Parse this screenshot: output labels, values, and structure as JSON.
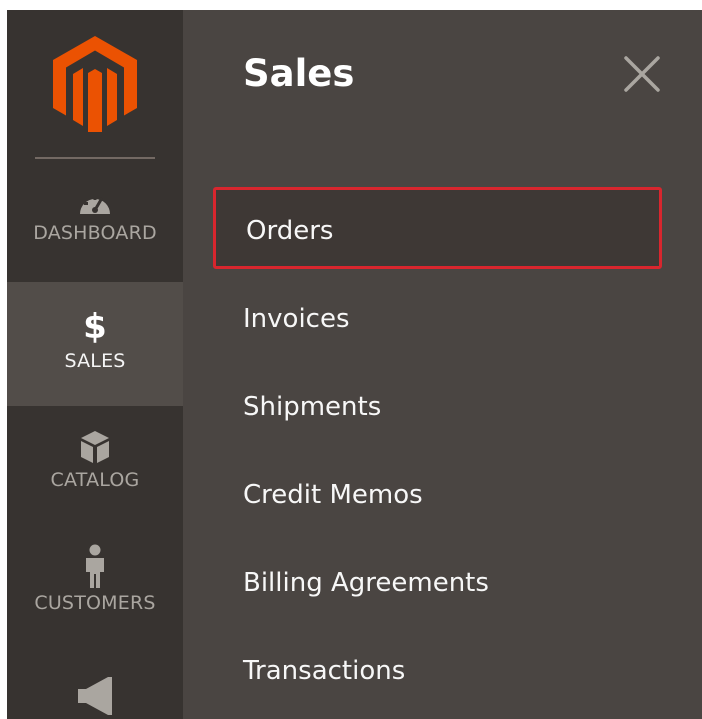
{
  "rail": {
    "items": [
      {
        "label": "DASHBOARD",
        "icon": "gauge-icon"
      },
      {
        "label": "SALES",
        "icon": "dollar-icon",
        "glyph": "$"
      },
      {
        "label": "CATALOG",
        "icon": "box-icon"
      },
      {
        "label": "CUSTOMERS",
        "icon": "person-icon"
      },
      {
        "label": "",
        "icon": "megaphone-icon"
      }
    ]
  },
  "panel": {
    "title": "Sales",
    "menu": [
      {
        "label": "Orders",
        "state": "highlighted"
      },
      {
        "label": "Invoices"
      },
      {
        "label": "Shipments"
      },
      {
        "label": "Credit Memos"
      },
      {
        "label": "Billing Agreements"
      },
      {
        "label": "Transactions"
      }
    ]
  },
  "colors": {
    "brand_orange": "#eb5202",
    "rail_bg": "#373330",
    "panel_bg": "#4a4542",
    "active_rail_bg": "#524d49",
    "highlight_border": "#d8262e"
  }
}
